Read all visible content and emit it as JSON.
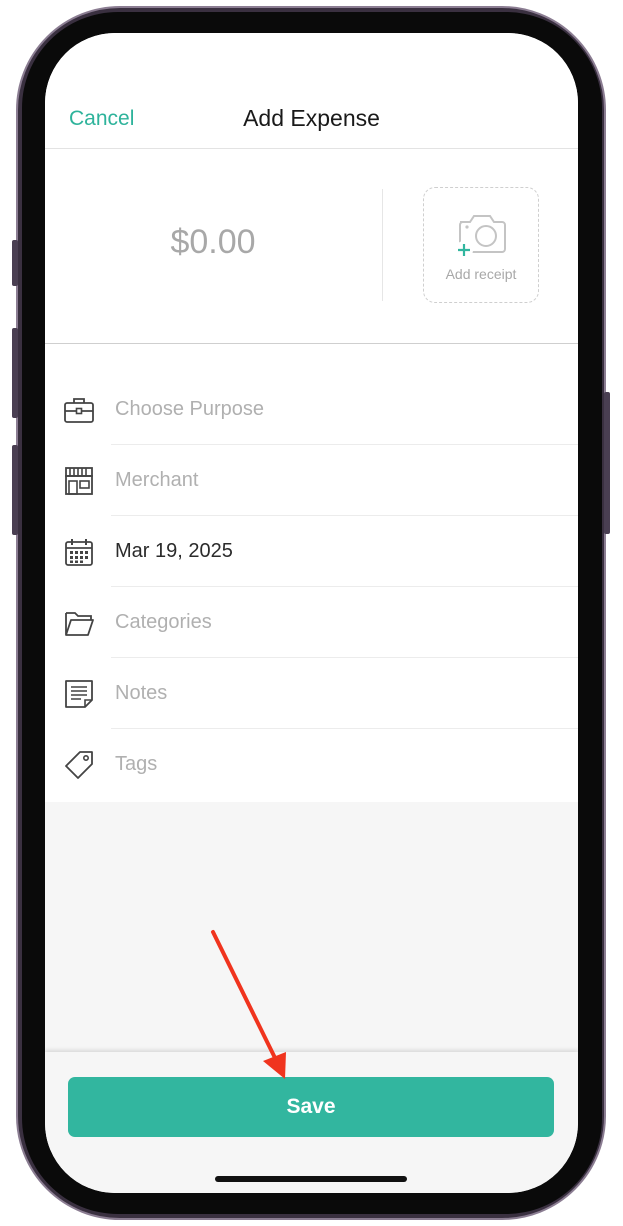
{
  "header": {
    "cancel_label": "Cancel",
    "title": "Add Expense"
  },
  "amount": {
    "value": "$0.00"
  },
  "receipt": {
    "label": "Add receipt"
  },
  "form": {
    "rows": [
      {
        "icon": "briefcase-icon",
        "text": "Choose Purpose",
        "filled": false
      },
      {
        "icon": "store-icon",
        "text": "Merchant",
        "filled": false
      },
      {
        "icon": "calendar-icon",
        "text": "Mar 19, 2025",
        "filled": true
      },
      {
        "icon": "folder-icon",
        "text": "Categories",
        "filled": false
      },
      {
        "icon": "notes-icon",
        "text": "Notes",
        "filled": false
      },
      {
        "icon": "tag-icon",
        "text": "Tags",
        "filled": false
      }
    ]
  },
  "footer": {
    "save_label": "Save"
  },
  "colors": {
    "accent": "#32b69f",
    "annotation_arrow": "#f0341e"
  }
}
